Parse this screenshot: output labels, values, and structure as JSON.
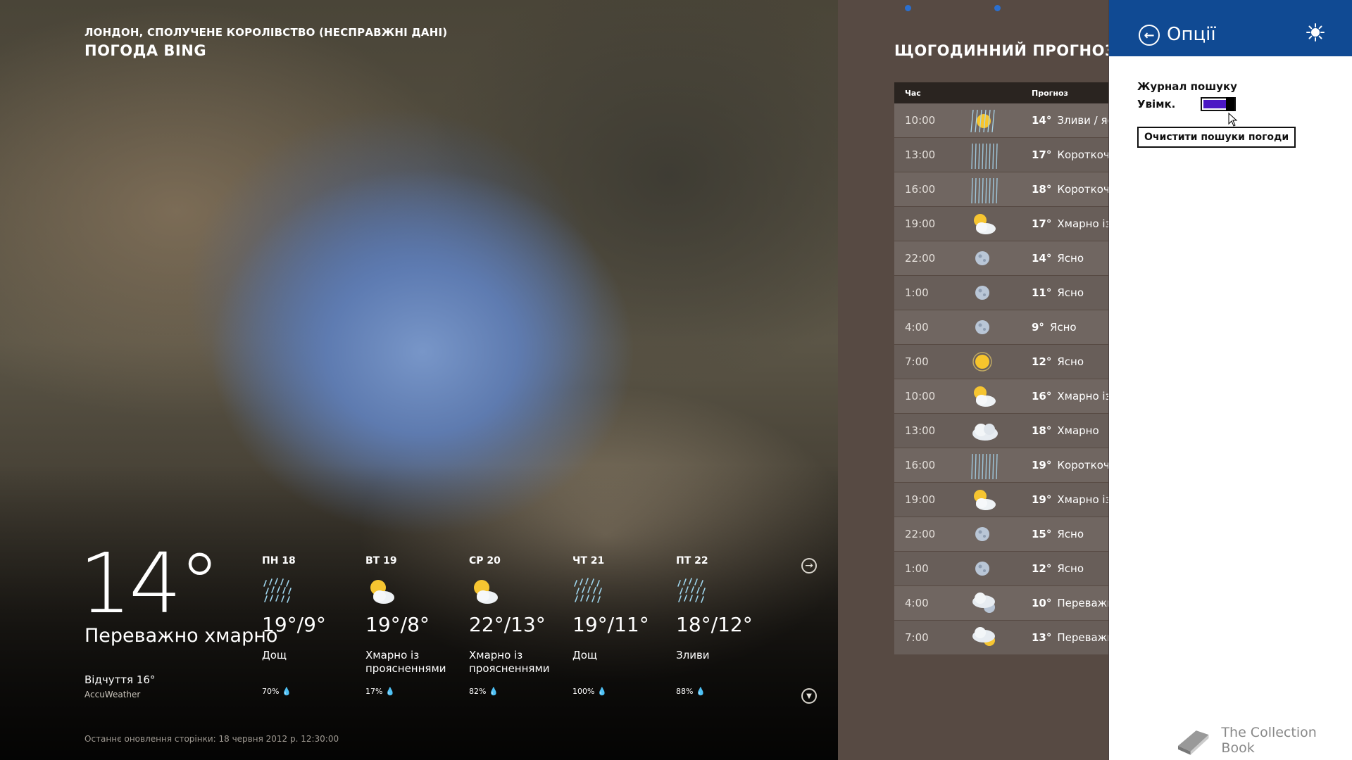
{
  "app": {
    "location": "ЛОНДОН, СПОЛУЧЕНЕ КОРОЛІВСТВО (НЕСПРАВЖНІ ДАНІ)",
    "name": "ПОГОДА BING"
  },
  "current": {
    "temp": "14°",
    "condition": "Переважно хмарно",
    "feels_like": "Відчуття 16°",
    "provider": "AccuWeather",
    "updated": "Останнє оновлення сторінки: 18 червня 2012 р. 12:30:00"
  },
  "daily": [
    {
      "day": "ПН 18",
      "temp": "19°/9°",
      "desc": "Дощ",
      "precip": "70%",
      "icon": "rain-icon"
    },
    {
      "day": "ВТ 19",
      "temp": "19°/8°",
      "desc": "Хмарно із проясненнями",
      "precip": "17%",
      "icon": "partly-cloudy-icon"
    },
    {
      "day": "СР 20",
      "temp": "22°/13°",
      "desc": "Хмарно із проясненнями",
      "precip": "82%",
      "icon": "partly-cloudy-icon"
    },
    {
      "day": "ЧТ 21",
      "temp": "19°/11°",
      "desc": "Дощ",
      "precip": "100%",
      "icon": "rain-icon"
    },
    {
      "day": "ПТ 22",
      "temp": "18°/12°",
      "desc": "Зливи",
      "precip": "88%",
      "icon": "rain-icon"
    }
  ],
  "hourly": {
    "title": "ЩОГОДИННИЙ ПРОГНОЗ",
    "col_time": "Час",
    "col_forecast": "Прогноз",
    "rows": [
      {
        "time": "10:00",
        "temp": "14°",
        "desc": "Зливи / ясно",
        "icon": "sun-showers-icon"
      },
      {
        "time": "13:00",
        "temp": "17°",
        "desc": "Короткочасні зливи",
        "icon": "heavy-rain-icon"
      },
      {
        "time": "16:00",
        "temp": "18°",
        "desc": "Короткочасні зливи",
        "icon": "heavy-rain-icon"
      },
      {
        "time": "19:00",
        "temp": "17°",
        "desc": "Хмарно із проясненнями",
        "icon": "partly-cloudy-icon"
      },
      {
        "time": "22:00",
        "temp": "14°",
        "desc": "Ясно",
        "icon": "moon-icon"
      },
      {
        "time": "1:00",
        "temp": "11°",
        "desc": "Ясно",
        "icon": "moon-icon"
      },
      {
        "time": "4:00",
        "temp": "9°",
        "desc": "Ясно",
        "icon": "moon-icon"
      },
      {
        "time": "7:00",
        "temp": "12°",
        "desc": "Ясно",
        "icon": "sun-icon"
      },
      {
        "time": "10:00",
        "temp": "16°",
        "desc": "Хмарно із проясненнями",
        "icon": "partly-cloudy-icon"
      },
      {
        "time": "13:00",
        "temp": "18°",
        "desc": "Хмарно",
        "icon": "cloud-icon"
      },
      {
        "time": "16:00",
        "temp": "19°",
        "desc": "Короткочасні зливи",
        "icon": "heavy-rain-icon"
      },
      {
        "time": "19:00",
        "temp": "19°",
        "desc": "Хмарно із проясненнями",
        "icon": "partly-cloudy-icon"
      },
      {
        "time": "22:00",
        "temp": "15°",
        "desc": "Ясно",
        "icon": "moon-icon"
      },
      {
        "time": "1:00",
        "temp": "12°",
        "desc": "Ясно",
        "icon": "moon-icon"
      },
      {
        "time": "4:00",
        "temp": "10°",
        "desc": "Переважно хмарно",
        "icon": "mostly-cloudy-night-icon"
      },
      {
        "time": "7:00",
        "temp": "13°",
        "desc": "Переважно хмарно",
        "icon": "mostly-cloudy-icon"
      }
    ]
  },
  "options": {
    "title": "Опції",
    "search_history_label": "Журнал пошуку",
    "search_history_state": "Увімк.",
    "search_history_on": true,
    "clear_button": "Очистити пошуки погоди"
  },
  "watermark": "The Collection Book",
  "colors": {
    "flyout_header": "#104a93",
    "toggle_fill": "#4b17c4",
    "panel_bg": "#574a43",
    "scroll_dot": "#2a6fd0"
  }
}
